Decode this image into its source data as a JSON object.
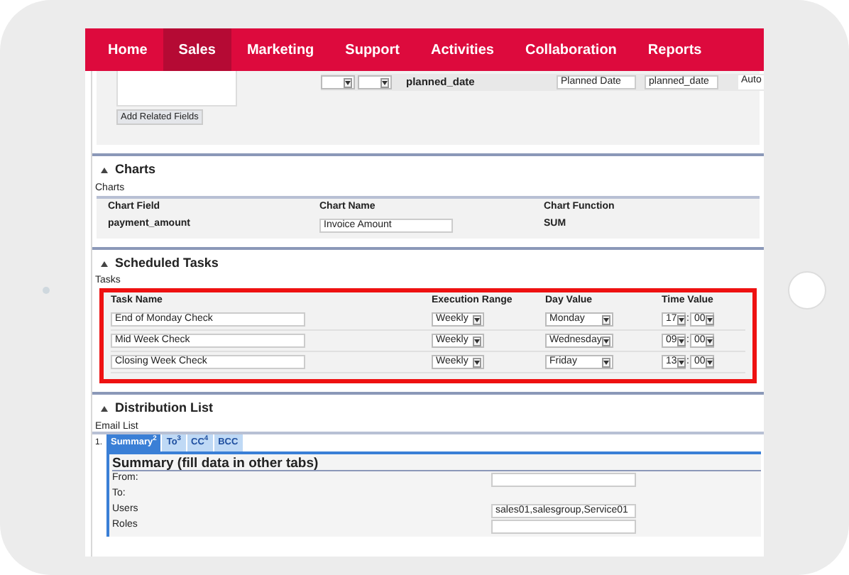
{
  "nav": [
    {
      "label": "Home",
      "selected": false
    },
    {
      "label": "Sales",
      "selected": true
    },
    {
      "label": "Marketing",
      "selected": false
    },
    {
      "label": "Support",
      "selected": false
    },
    {
      "label": "Activities",
      "selected": false
    },
    {
      "label": "Collaboration",
      "selected": false
    },
    {
      "label": "Reports",
      "selected": false
    }
  ],
  "related": {
    "button": "Add Related Fields",
    "field": "planned_date",
    "label_value": "Planned Date",
    "name_value": "planned_date",
    "mode": "Auto"
  },
  "charts": {
    "title": "Charts",
    "subtitle": "Charts",
    "columns": [
      "Chart Field",
      "Chart Name",
      "Chart Function"
    ],
    "row": {
      "field": "payment_amount",
      "name": "Invoice Amount",
      "function": "SUM"
    }
  },
  "scheduled": {
    "title": "Scheduled Tasks",
    "subtitle": "Tasks",
    "columns": [
      "Task Name",
      "Execution Range",
      "Day Value",
      "Time Value"
    ],
    "rows": [
      {
        "name": "End of Monday Check",
        "range": "Weekly",
        "day": "Monday",
        "hour": "17",
        "separator": ":",
        "minute": "00"
      },
      {
        "name": "Mid Week Check",
        "range": "Weekly",
        "day": "Wednesday",
        "hour": "09",
        "separator": ":",
        "minute": "00"
      },
      {
        "name": "Closing Week Check",
        "range": "Weekly",
        "day": "Friday",
        "hour": "13",
        "separator": ":",
        "minute": "00"
      }
    ]
  },
  "distribution": {
    "title": "Distribution List",
    "subtitle": "Email List",
    "index": "1.",
    "tabs": [
      {
        "label": "Summary$^{2}$",
        "selected": true
      },
      {
        "label": "To$^{3}$",
        "selected": false
      },
      {
        "label": "CC$^{4}$",
        "selected": false
      },
      {
        "label": "BCC",
        "selected": false
      }
    ],
    "summary_title": "Summary (fill data in other tabs)",
    "fields": [
      {
        "label": "From:",
        "kind": "input"
      },
      {
        "label": "To:",
        "kind": "label"
      },
      {
        "label": "Users",
        "kind": "input",
        "value": "sales01,salesgroup,Service01"
      },
      {
        "label": "Roles",
        "kind": "input"
      }
    ]
  }
}
